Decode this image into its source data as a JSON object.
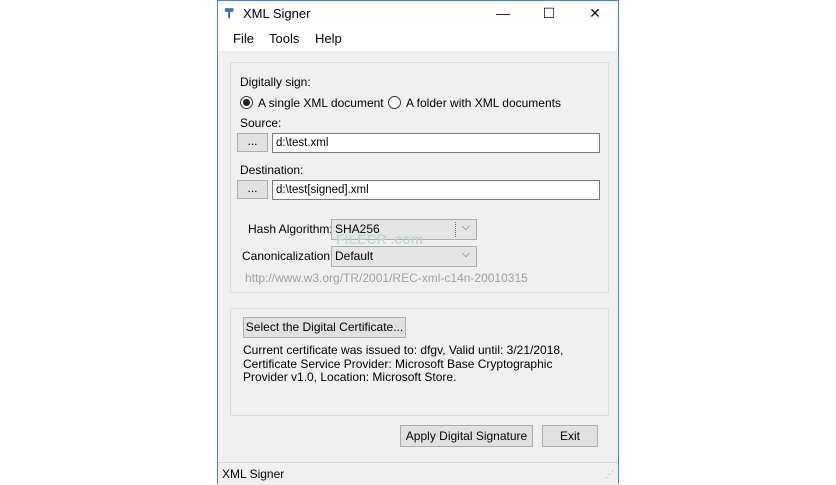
{
  "window": {
    "title": "XML Signer",
    "minimize": "—",
    "maximize": "☐",
    "close": "✕"
  },
  "menu": {
    "file": "File",
    "tools": "Tools",
    "help": "Help"
  },
  "sign": {
    "label": "Digitally sign:",
    "option_single": "A single XML document",
    "option_folder": "A folder with XML documents",
    "selected": "single",
    "source_label": "Source:",
    "source_value": "d:\\test.xml",
    "destination_label": "Destination:",
    "destination_value": "d:\\test[signed].xml",
    "browse_label": "...",
    "hash_label": "Hash Algorithm:",
    "hash_value": "SHA256",
    "canon_label": "Canonicalization:",
    "canon_value": "Default",
    "canon_url": "http://www.w3.org/TR/2001/REC-xml-c14n-20010315"
  },
  "certificate": {
    "button": "Select the Digital Certificate...",
    "info": "Current certificate was issued to: dfgv, Valid until: 3/21/2018, Certificate Service Provider: Microsoft Base Cryptographic Provider v1.0, Location: Microsoft Store."
  },
  "actions": {
    "apply": "Apply Digital Signature",
    "exit": "Exit"
  },
  "status": {
    "text": "XML Signer"
  },
  "watermark": "FILECR .com"
}
